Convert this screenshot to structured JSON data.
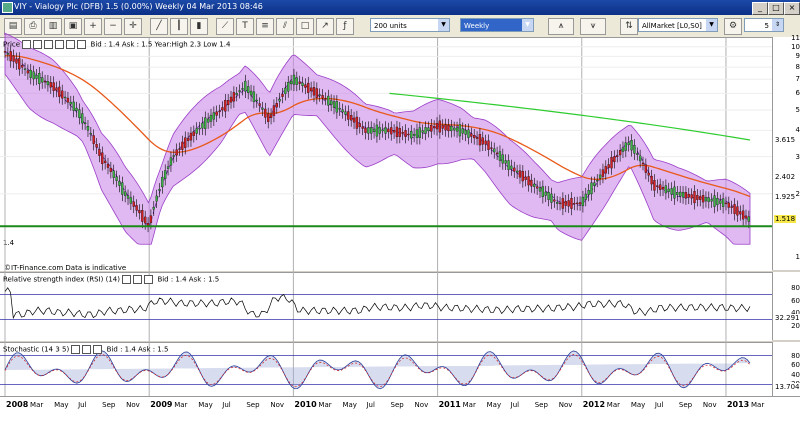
{
  "window": {
    "title": "VIY - Vialogy Plc (DFB)    1.5 (0.00%)    Weekly  04 Mar 2013 08:46",
    "min": "_",
    "max": "□",
    "close": "×"
  },
  "toolbar": {
    "units": "200 units",
    "period": "Weekly",
    "indicator": "AllMarket [L0,S0]",
    "count": "5"
  },
  "price_panel": {
    "header": "Price",
    "info": "Bid : 1.4 Ask : 1.5 Year:High 2.3 Low 1.4",
    "source": "©IT-Finance.com  Data is indicative",
    "left_marker": "1.4",
    "ticks": [
      "11",
      "10",
      "9",
      "8",
      "7",
      "6",
      "5",
      "4",
      "3",
      "2",
      "1"
    ],
    "tags": {
      "upper_ma": "3.615",
      "ema": "2.402",
      "bb_mid": "1.925",
      "last": "1.518"
    }
  },
  "rsi_panel": {
    "header": "Relative strength index (RSI) (14)",
    "info": "Bid : 1.4 Ask : 1.5",
    "ticks": [
      "80",
      "60",
      "40",
      "20"
    ],
    "tag": "32.291"
  },
  "stoch_panel": {
    "header": "Stochastic (14 3 5)",
    "info": "Bid : 1.4 Ask : 1.5",
    "ticks": [
      "80",
      "60",
      "40",
      "20"
    ],
    "tag": "13.704"
  },
  "x_axis": [
    {
      "t": "2008",
      "yr": true
    },
    {
      "t": "Mar"
    },
    {
      "t": "May"
    },
    {
      "t": "Jul"
    },
    {
      "t": "Sep"
    },
    {
      "t": "Nov"
    },
    {
      "t": "2009",
      "yr": true
    },
    {
      "t": "Mar"
    },
    {
      "t": "May"
    },
    {
      "t": "Jul"
    },
    {
      "t": "Sep"
    },
    {
      "t": "Nov"
    },
    {
      "t": "2010",
      "yr": true
    },
    {
      "t": "Mar"
    },
    {
      "t": "May"
    },
    {
      "t": "Jul"
    },
    {
      "t": "Sep"
    },
    {
      "t": "Nov"
    },
    {
      "t": "2011",
      "yr": true
    },
    {
      "t": "Mar"
    },
    {
      "t": "May"
    },
    {
      "t": "Jul"
    },
    {
      "t": "Sep"
    },
    {
      "t": "Nov"
    },
    {
      "t": "2012",
      "yr": true
    },
    {
      "t": "Mar"
    },
    {
      "t": "May"
    },
    {
      "t": "Jul"
    },
    {
      "t": "Sep"
    },
    {
      "t": "Nov"
    },
    {
      "t": "2013",
      "yr": true
    },
    {
      "t": "Mar"
    }
  ],
  "chart_data": {
    "type": "line",
    "x_range": [
      "2008-01",
      "2013-03"
    ],
    "ylim": [
      1,
      11
    ],
    "log_scale": true,
    "series": [],
    "close_approx": [
      [
        "2008-01",
        9.5
      ],
      [
        "2008-03",
        7.5
      ],
      [
        "2008-05",
        6.5
      ],
      [
        "2008-07",
        5.0
      ],
      [
        "2008-09",
        3.0
      ],
      [
        "2008-11",
        2.0
      ],
      [
        "2009-01",
        1.4
      ],
      [
        "2009-03",
        3.0
      ],
      [
        "2009-05",
        4.0
      ],
      [
        "2009-07",
        5.0
      ],
      [
        "2009-09",
        6.5
      ],
      [
        "2009-11",
        4.5
      ],
      [
        "2010-01",
        7.0
      ],
      [
        "2010-03",
        6.0
      ],
      [
        "2010-05",
        5.0
      ],
      [
        "2010-07",
        4.0
      ],
      [
        "2010-09",
        4.0
      ],
      [
        "2010-11",
        3.8
      ],
      [
        "2011-01",
        4.2
      ],
      [
        "2011-03",
        4.0
      ],
      [
        "2011-05",
        3.5
      ],
      [
        "2011-07",
        2.7
      ],
      [
        "2011-09",
        2.2
      ],
      [
        "2011-11",
        1.8
      ],
      [
        "2012-01",
        1.8
      ],
      [
        "2012-03",
        2.6
      ],
      [
        "2012-05",
        3.5
      ],
      [
        "2012-07",
        2.2
      ],
      [
        "2012-09",
        2.0
      ],
      [
        "2012-11",
        1.9
      ],
      [
        "2013-01",
        1.8
      ],
      [
        "2013-03",
        1.5
      ]
    ],
    "horizontal_line": 1.4,
    "colors": {
      "bands": "#c77ee8",
      "ema": "#e8591a",
      "long_ma": "#2ecc2e",
      "support": "#1a8a1a",
      "up": "#3cb043",
      "down": "#d02020"
    }
  }
}
